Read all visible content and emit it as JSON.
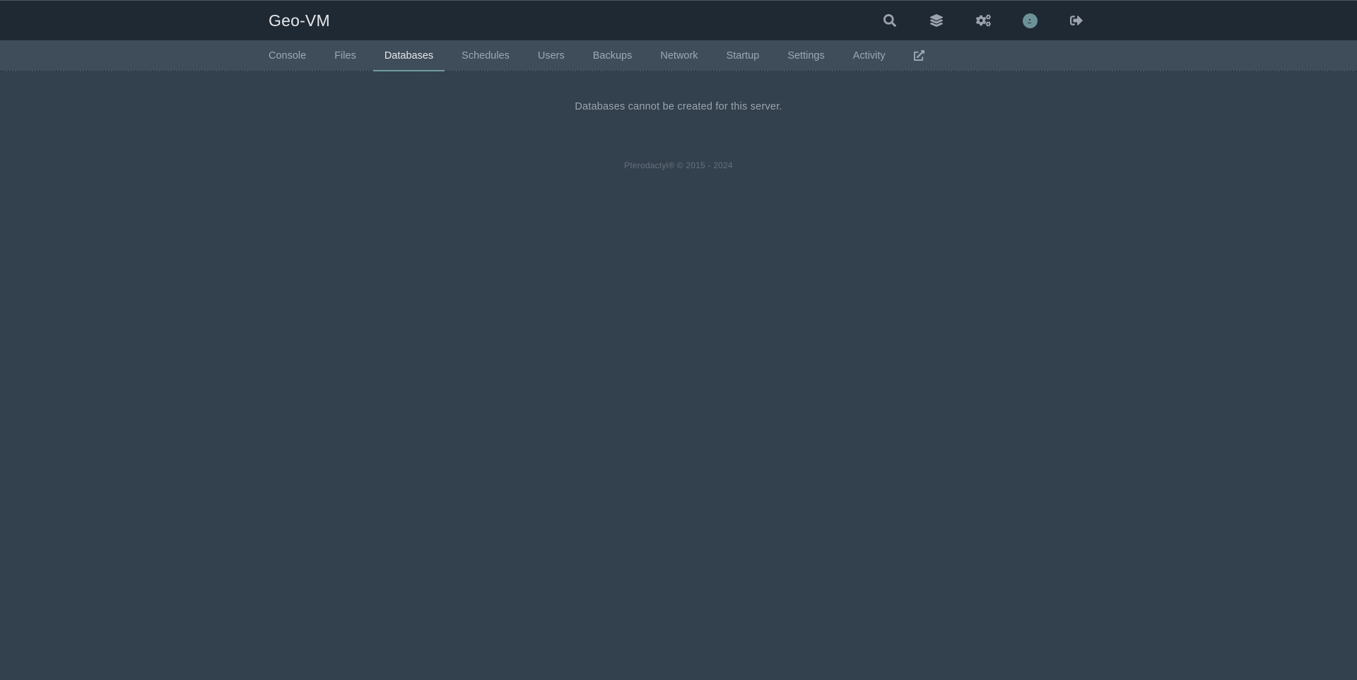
{
  "header": {
    "title": "Geo-VM",
    "actions": [
      {
        "name": "search",
        "icon": "search-icon"
      },
      {
        "name": "layers",
        "icon": "layers-icon"
      },
      {
        "name": "admin",
        "icon": "cogs-icon"
      },
      {
        "name": "account",
        "icon": "avatar-icon"
      },
      {
        "name": "logout",
        "icon": "sign-out-icon"
      }
    ]
  },
  "nav": {
    "tabs": [
      {
        "label": "Console",
        "active": false
      },
      {
        "label": "Files",
        "active": false
      },
      {
        "label": "Databases",
        "active": true
      },
      {
        "label": "Schedules",
        "active": false
      },
      {
        "label": "Users",
        "active": false
      },
      {
        "label": "Backups",
        "active": false
      },
      {
        "label": "Network",
        "active": false
      },
      {
        "label": "Startup",
        "active": false
      },
      {
        "label": "Settings",
        "active": false
      },
      {
        "label": "Activity",
        "active": false
      }
    ],
    "external_icon": "external-link-icon"
  },
  "main": {
    "message": "Databases cannot be created for this server."
  },
  "footer": {
    "text": "Pterodactyl® © 2015 - 2024"
  },
  "colors": {
    "topbar": "#1f2933",
    "subnav": "#3f4d5a",
    "background": "#33404d",
    "active_tab_underline": "#6e9c9f"
  }
}
